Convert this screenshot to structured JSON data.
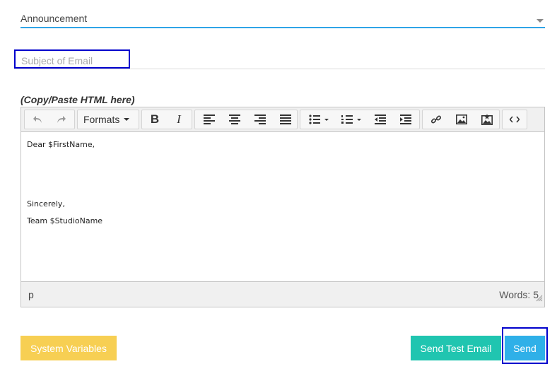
{
  "category": {
    "value": "Announcement"
  },
  "subject": {
    "placeholder": "Subject of Email",
    "value": ""
  },
  "html_hint": "(Copy/Paste HTML here)",
  "toolbar": {
    "formats_label": "Formats",
    "icons": [
      "undo-icon",
      "redo-icon",
      "bold-icon",
      "italic-icon",
      "align-left-icon",
      "align-center-icon",
      "align-right-icon",
      "justify-icon",
      "bullet-list-icon",
      "numbered-list-icon",
      "outdent-icon",
      "indent-icon",
      "link-icon",
      "image-icon",
      "media-icon",
      "source-code-icon"
    ]
  },
  "content": {
    "lines": [
      "Dear $FirstName,",
      "",
      "",
      "",
      "Sincerely,",
      "Team $StudioName"
    ]
  },
  "statusbar": {
    "path": "p",
    "wordcount": "Words: 5"
  },
  "buttons": {
    "system_variables": "System Variables",
    "send_test": "Send Test Email",
    "send": "Send"
  },
  "colors": {
    "accent": "#2fa4e7",
    "vars_button": "#f7cf53",
    "test_button": "#20c5b0",
    "send_button": "#2fb0e8",
    "highlight_outline": "#0000cc"
  }
}
